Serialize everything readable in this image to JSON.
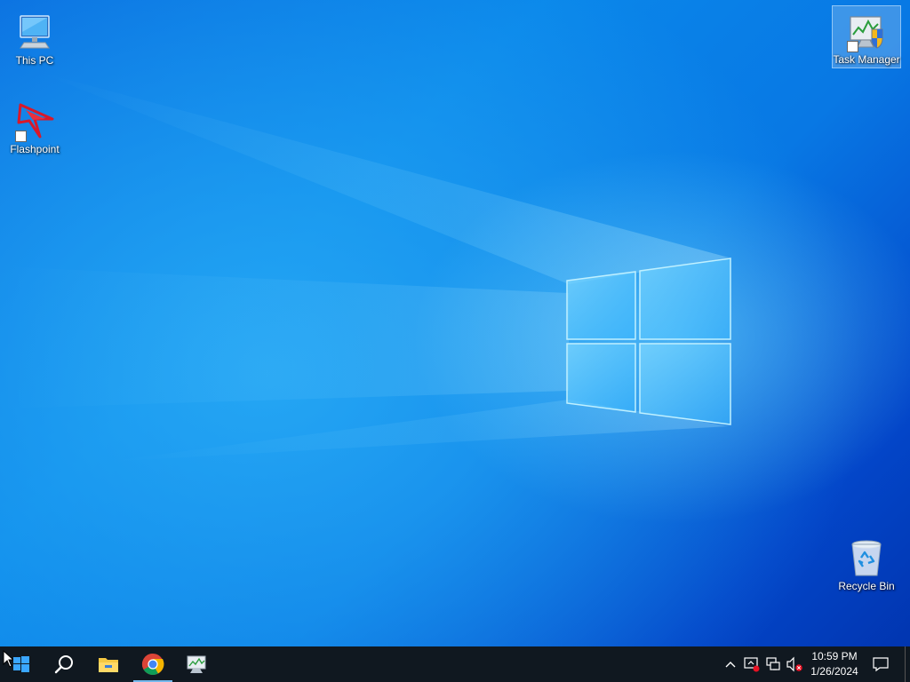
{
  "desktop": {
    "icons": [
      {
        "label": "This PC",
        "icon": "computer-icon"
      },
      {
        "label": "Flashpoint",
        "icon": "flashpoint-icon"
      },
      {
        "label": "Task Manager",
        "icon": "task-manager-icon"
      },
      {
        "label": "Recycle Bin",
        "icon": "recycle-bin-icon"
      }
    ]
  },
  "taskbar": {
    "pinned": [
      {
        "name": "start",
        "icon": "windows-start-icon"
      },
      {
        "name": "search",
        "icon": "search-icon"
      },
      {
        "name": "file-explorer",
        "icon": "folder-icon"
      },
      {
        "name": "chrome",
        "icon": "chrome-icon"
      },
      {
        "name": "task-manager",
        "icon": "task-manager-icon"
      }
    ],
    "tray": {
      "icons": [
        "chevron-up-icon",
        "security-icon",
        "network-icon",
        "volume-muted-icon"
      ],
      "time": "10:59 PM",
      "date": "1/26/2024",
      "notification_icon": "notification-icon"
    }
  },
  "colors": {
    "taskbar_bg": "#101820",
    "active_indicator": "#76b9ed",
    "chrome_red": "#db4437",
    "chrome_yellow": "#f4b400",
    "chrome_green": "#0f9d58",
    "chrome_blue": "#4285f4",
    "folder_yellow": "#f5c842"
  }
}
